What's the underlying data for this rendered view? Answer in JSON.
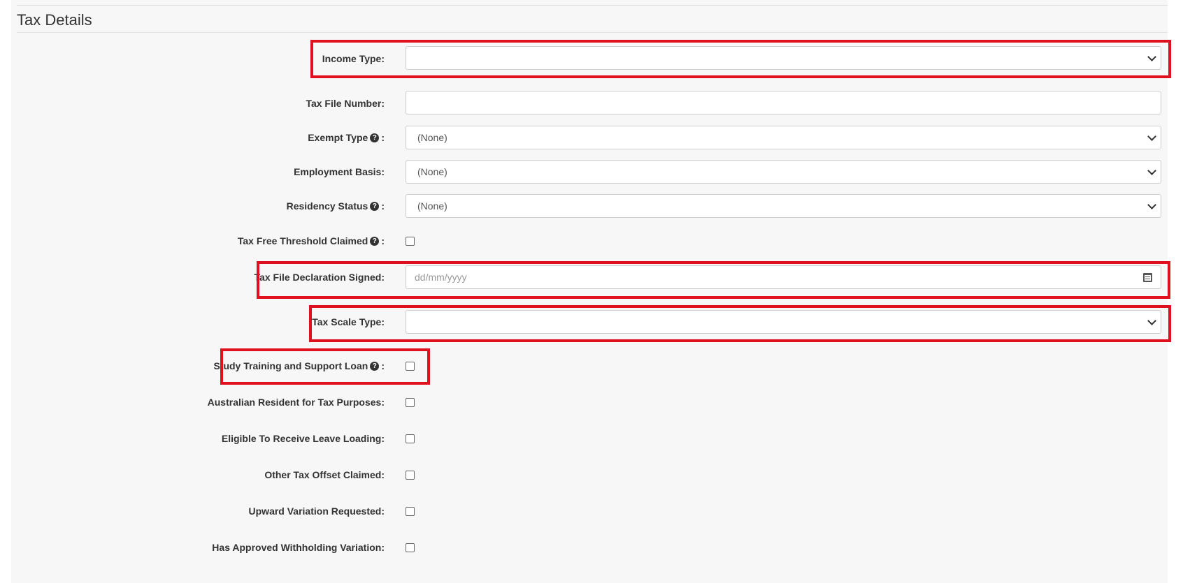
{
  "section": {
    "title": "Tax Details"
  },
  "fields": {
    "income_type": {
      "label": "Income Type:",
      "value": ""
    },
    "tax_file_number": {
      "label": "Tax File Number:",
      "value": ""
    },
    "exempt_type": {
      "label": "Exempt Type",
      "value": "(None)"
    },
    "employment_basis": {
      "label": "Employment Basis:",
      "value": "(None)"
    },
    "residency_status": {
      "label": "Residency Status",
      "value": "(None)"
    },
    "tax_free_threshold": {
      "label": "Tax Free Threshold Claimed",
      "checked": false
    },
    "tfd_signed": {
      "label": "Tax File Declaration Signed:",
      "placeholder": "dd/mm/yyyy"
    },
    "tax_scale_type": {
      "label": "Tax Scale Type:",
      "value": ""
    },
    "stsl": {
      "label": "Study Training and Support Loan",
      "checked": false
    },
    "australian_resident": {
      "label": "Australian Resident for Tax Purposes:",
      "checked": false
    },
    "leave_loading": {
      "label": "Eligible To Receive Leave Loading:",
      "checked": false
    },
    "tax_offset": {
      "label": "Other Tax Offset Claimed:",
      "checked": false
    },
    "upward_variation": {
      "label": "Upward Variation Requested:",
      "checked": false
    },
    "withholding_variation": {
      "label": "Has Approved Withholding Variation:",
      "checked": false
    }
  },
  "icons": {
    "help": "question-circle-icon",
    "calendar": "calendar-icon",
    "dropdown": "chevron-down-icon"
  },
  "colors": {
    "highlight": "#e0101e",
    "panel_bg": "#f7f7f7"
  },
  "suffix": {
    "colon": ":"
  },
  "help_glyph": "?"
}
